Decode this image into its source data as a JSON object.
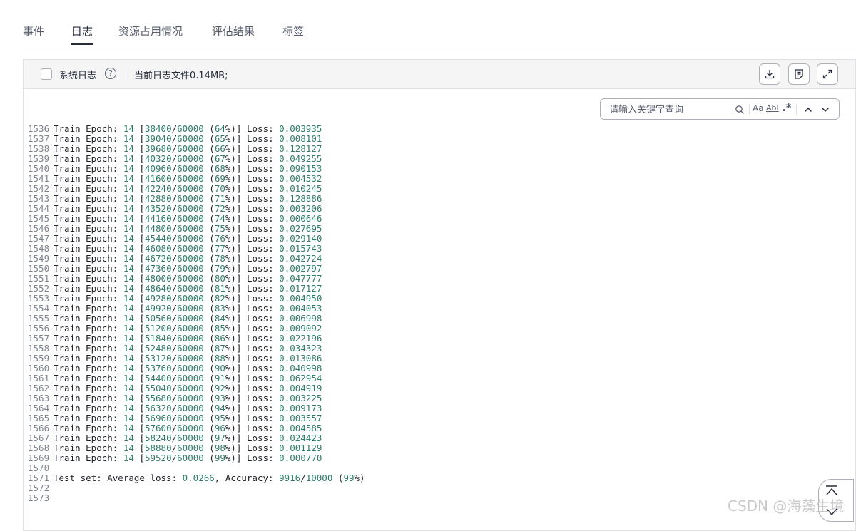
{
  "tabs": [
    {
      "label": "事件"
    },
    {
      "label": "日志"
    },
    {
      "label": "资源占用情况"
    },
    {
      "label": "评估结果"
    },
    {
      "label": "标签"
    }
  ],
  "toolbar": {
    "system_log_label": "系统日志",
    "help_symbol": "?",
    "file_size_text": "当前日志文件0.14MB;"
  },
  "search": {
    "placeholder": "请输入关键字查询",
    "match_case_label": "Aa",
    "whole_word_label": "Abl",
    "regex_label": ".*"
  },
  "log_lines": [
    {
      "n": "1536",
      "pre": "Train Epoch: ",
      "e": "14",
      "b": " [",
      "s": "38400",
      "sl": "/",
      "t": "60000",
      "p1": " (",
      "pc": "64",
      "p2": "%)] Loss: ",
      "loss": "0.003935"
    },
    {
      "n": "1537",
      "pre": "Train Epoch: ",
      "e": "14",
      "b": " [",
      "s": "39040",
      "sl": "/",
      "t": "60000",
      "p1": " (",
      "pc": "65",
      "p2": "%)] Loss: ",
      "loss": "0.008101"
    },
    {
      "n": "1538",
      "pre": "Train Epoch: ",
      "e": "14",
      "b": " [",
      "s": "39680",
      "sl": "/",
      "t": "60000",
      "p1": " (",
      "pc": "66",
      "p2": "%)] Loss: ",
      "loss": "0.128127"
    },
    {
      "n": "1539",
      "pre": "Train Epoch: ",
      "e": "14",
      "b": " [",
      "s": "40320",
      "sl": "/",
      "t": "60000",
      "p1": " (",
      "pc": "67",
      "p2": "%)] Loss: ",
      "loss": "0.049255"
    },
    {
      "n": "1540",
      "pre": "Train Epoch: ",
      "e": "14",
      "b": " [",
      "s": "40960",
      "sl": "/",
      "t": "60000",
      "p1": " (",
      "pc": "68",
      "p2": "%)] Loss: ",
      "loss": "0.090153"
    },
    {
      "n": "1541",
      "pre": "Train Epoch: ",
      "e": "14",
      "b": " [",
      "s": "41600",
      "sl": "/",
      "t": "60000",
      "p1": " (",
      "pc": "69",
      "p2": "%)] Loss: ",
      "loss": "0.004532"
    },
    {
      "n": "1542",
      "pre": "Train Epoch: ",
      "e": "14",
      "b": " [",
      "s": "42240",
      "sl": "/",
      "t": "60000",
      "p1": " (",
      "pc": "70",
      "p2": "%)] Loss: ",
      "loss": "0.010245"
    },
    {
      "n": "1543",
      "pre": "Train Epoch: ",
      "e": "14",
      "b": " [",
      "s": "42880",
      "sl": "/",
      "t": "60000",
      "p1": " (",
      "pc": "71",
      "p2": "%)] Loss: ",
      "loss": "0.128886"
    },
    {
      "n": "1544",
      "pre": "Train Epoch: ",
      "e": "14",
      "b": " [",
      "s": "43520",
      "sl": "/",
      "t": "60000",
      "p1": " (",
      "pc": "72",
      "p2": "%)] Loss: ",
      "loss": "0.003206"
    },
    {
      "n": "1545",
      "pre": "Train Epoch: ",
      "e": "14",
      "b": " [",
      "s": "44160",
      "sl": "/",
      "t": "60000",
      "p1": " (",
      "pc": "74",
      "p2": "%)] Loss: ",
      "loss": "0.000646"
    },
    {
      "n": "1546",
      "pre": "Train Epoch: ",
      "e": "14",
      "b": " [",
      "s": "44800",
      "sl": "/",
      "t": "60000",
      "p1": " (",
      "pc": "75",
      "p2": "%)] Loss: ",
      "loss": "0.027695"
    },
    {
      "n": "1547",
      "pre": "Train Epoch: ",
      "e": "14",
      "b": " [",
      "s": "45440",
      "sl": "/",
      "t": "60000",
      "p1": " (",
      "pc": "76",
      "p2": "%)] Loss: ",
      "loss": "0.029140"
    },
    {
      "n": "1548",
      "pre": "Train Epoch: ",
      "e": "14",
      "b": " [",
      "s": "46080",
      "sl": "/",
      "t": "60000",
      "p1": " (",
      "pc": "77",
      "p2": "%)] Loss: ",
      "loss": "0.015743"
    },
    {
      "n": "1549",
      "pre": "Train Epoch: ",
      "e": "14",
      "b": " [",
      "s": "46720",
      "sl": "/",
      "t": "60000",
      "p1": " (",
      "pc": "78",
      "p2": "%)] Loss: ",
      "loss": "0.042724"
    },
    {
      "n": "1550",
      "pre": "Train Epoch: ",
      "e": "14",
      "b": " [",
      "s": "47360",
      "sl": "/",
      "t": "60000",
      "p1": " (",
      "pc": "79",
      "p2": "%)] Loss: ",
      "loss": "0.002797"
    },
    {
      "n": "1551",
      "pre": "Train Epoch: ",
      "e": "14",
      "b": " [",
      "s": "48000",
      "sl": "/",
      "t": "60000",
      "p1": " (",
      "pc": "80",
      "p2": "%)] Loss: ",
      "loss": "0.047777"
    },
    {
      "n": "1552",
      "pre": "Train Epoch: ",
      "e": "14",
      "b": " [",
      "s": "48640",
      "sl": "/",
      "t": "60000",
      "p1": " (",
      "pc": "81",
      "p2": "%)] Loss: ",
      "loss": "0.017127"
    },
    {
      "n": "1553",
      "pre": "Train Epoch: ",
      "e": "14",
      "b": " [",
      "s": "49280",
      "sl": "/",
      "t": "60000",
      "p1": " (",
      "pc": "82",
      "p2": "%)] Loss: ",
      "loss": "0.004950"
    },
    {
      "n": "1554",
      "pre": "Train Epoch: ",
      "e": "14",
      "b": " [",
      "s": "49920",
      "sl": "/",
      "t": "60000",
      "p1": " (",
      "pc": "83",
      "p2": "%)] Loss: ",
      "loss": "0.004053"
    },
    {
      "n": "1555",
      "pre": "Train Epoch: ",
      "e": "14",
      "b": " [",
      "s": "50560",
      "sl": "/",
      "t": "60000",
      "p1": " (",
      "pc": "84",
      "p2": "%)] Loss: ",
      "loss": "0.006998"
    },
    {
      "n": "1556",
      "pre": "Train Epoch: ",
      "e": "14",
      "b": " [",
      "s": "51200",
      "sl": "/",
      "t": "60000",
      "p1": " (",
      "pc": "85",
      "p2": "%)] Loss: ",
      "loss": "0.009092"
    },
    {
      "n": "1557",
      "pre": "Train Epoch: ",
      "e": "14",
      "b": " [",
      "s": "51840",
      "sl": "/",
      "t": "60000",
      "p1": " (",
      "pc": "86",
      "p2": "%)] Loss: ",
      "loss": "0.022196"
    },
    {
      "n": "1558",
      "pre": "Train Epoch: ",
      "e": "14",
      "b": " [",
      "s": "52480",
      "sl": "/",
      "t": "60000",
      "p1": " (",
      "pc": "87",
      "p2": "%)] Loss: ",
      "loss": "0.034323"
    },
    {
      "n": "1559",
      "pre": "Train Epoch: ",
      "e": "14",
      "b": " [",
      "s": "53120",
      "sl": "/",
      "t": "60000",
      "p1": " (",
      "pc": "88",
      "p2": "%)] Loss: ",
      "loss": "0.013086"
    },
    {
      "n": "1560",
      "pre": "Train Epoch: ",
      "e": "14",
      "b": " [",
      "s": "53760",
      "sl": "/",
      "t": "60000",
      "p1": " (",
      "pc": "90",
      "p2": "%)] Loss: ",
      "loss": "0.040998"
    },
    {
      "n": "1561",
      "pre": "Train Epoch: ",
      "e": "14",
      "b": " [",
      "s": "54400",
      "sl": "/",
      "t": "60000",
      "p1": " (",
      "pc": "91",
      "p2": "%)] Loss: ",
      "loss": "0.062954"
    },
    {
      "n": "1562",
      "pre": "Train Epoch: ",
      "e": "14",
      "b": " [",
      "s": "55040",
      "sl": "/",
      "t": "60000",
      "p1": " (",
      "pc": "92",
      "p2": "%)] Loss: ",
      "loss": "0.004919"
    },
    {
      "n": "1563",
      "pre": "Train Epoch: ",
      "e": "14",
      "b": " [",
      "s": "55680",
      "sl": "/",
      "t": "60000",
      "p1": " (",
      "pc": "93",
      "p2": "%)] Loss: ",
      "loss": "0.003225"
    },
    {
      "n": "1564",
      "pre": "Train Epoch: ",
      "e": "14",
      "b": " [",
      "s": "56320",
      "sl": "/",
      "t": "60000",
      "p1": " (",
      "pc": "94",
      "p2": "%)] Loss: ",
      "loss": "0.009173"
    },
    {
      "n": "1565",
      "pre": "Train Epoch: ",
      "e": "14",
      "b": " [",
      "s": "56960",
      "sl": "/",
      "t": "60000",
      "p1": " (",
      "pc": "95",
      "p2": "%)] Loss: ",
      "loss": "0.003557"
    },
    {
      "n": "1566",
      "pre": "Train Epoch: ",
      "e": "14",
      "b": " [",
      "s": "57600",
      "sl": "/",
      "t": "60000",
      "p1": " (",
      "pc": "96",
      "p2": "%)] Loss: ",
      "loss": "0.004585"
    },
    {
      "n": "1567",
      "pre": "Train Epoch: ",
      "e": "14",
      "b": " [",
      "s": "58240",
      "sl": "/",
      "t": "60000",
      "p1": " (",
      "pc": "97",
      "p2": "%)] Loss: ",
      "loss": "0.024423"
    },
    {
      "n": "1568",
      "pre": "Train Epoch: ",
      "e": "14",
      "b": " [",
      "s": "58880",
      "sl": "/",
      "t": "60000",
      "p1": " (",
      "pc": "98",
      "p2": "%)] Loss: ",
      "loss": "0.001129"
    },
    {
      "n": "1569",
      "pre": "Train Epoch: ",
      "e": "14",
      "b": " [",
      "s": "59520",
      "sl": "/",
      "t": "60000",
      "p1": " (",
      "pc": "99",
      "p2": "%)] Loss: ",
      "loss": "0.000770"
    },
    {
      "n": "1570"
    },
    {
      "n": "1571",
      "pre": "Test set: Average loss: ",
      "e": "0.0266",
      "b": ", Accuracy: ",
      "s": "9916",
      "sl": "/",
      "t": "10000",
      "p1": " (",
      "pc": "99",
      "p2": "%)"
    },
    {
      "n": "1572"
    },
    {
      "n": "1573"
    }
  ],
  "watermark": "CSDN @海藻生境",
  "colors": {
    "number": "#2e7d6b",
    "line_number": "#7e8590",
    "text": "#1f2329",
    "border": "#dfe1e6",
    "toolbar_bg": "#f5f5f6"
  }
}
